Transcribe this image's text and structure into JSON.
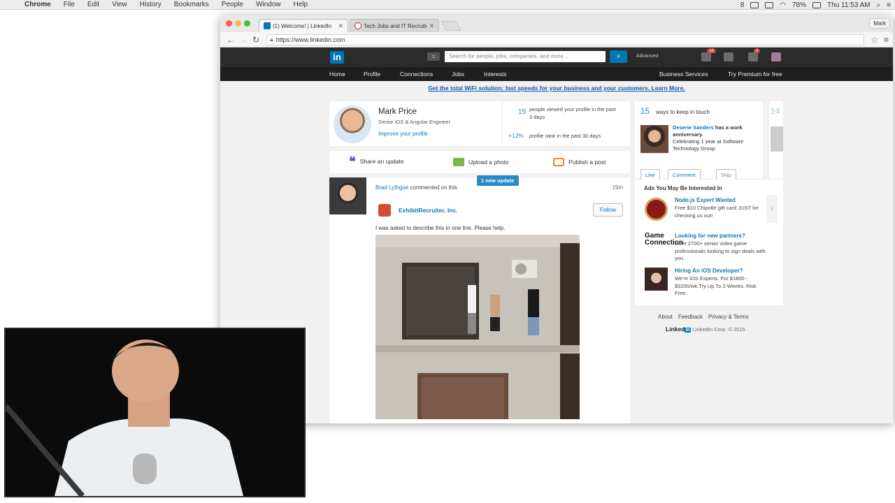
{
  "menubar": {
    "app": "Chrome",
    "items": [
      "File",
      "Edit",
      "View",
      "History",
      "Bookmarks",
      "People",
      "Window",
      "Help"
    ],
    "battery": "78%",
    "clock": "Thu 11:53 AM",
    "notif_count": "8"
  },
  "browser": {
    "tabs": [
      {
        "title": "(1) Welcome! | LinkedIn",
        "active": true
      },
      {
        "title": "Tech Jobs and IT Recruite",
        "active": false
      }
    ],
    "profile_name": "Mark",
    "url": "https://www.linkedin.com"
  },
  "linkedin": {
    "logo": "in",
    "search_placeholder": "Search for people, jobs, companies, and more...",
    "advanced": "Advanced",
    "messages_badge": "18",
    "notifications_badge": "3",
    "nav": [
      "Home",
      "Profile",
      "Connections",
      "Jobs",
      "Interests"
    ],
    "nav_right": [
      "Business Services",
      "Try Premium for free"
    ],
    "banner": "Get the total WiFi solution: fast speeds for your business and your customers. Learn More.",
    "profile": {
      "name": "Mark Price",
      "title": "Senior iOS & Angular Engineer",
      "improve": "Improve your profile",
      "views_num": "15",
      "views_text": "people viewed your profile in the past 3 days",
      "rank_num": "+12%",
      "rank_text": "profile rank in the past 30 days"
    },
    "share": {
      "update": "Share an update",
      "photo": "Upload a photo",
      "post": "Publish a post"
    },
    "new_update": "1 new update",
    "feed": {
      "actor": "Brad Lythgoe",
      "action": "commented on this",
      "time": "19m",
      "company": "ExhibitRecruiter, Inc.",
      "follow": "Follow",
      "text": "I was asked to describe this in one line. Please help."
    },
    "keep_in_touch": {
      "num": "15",
      "label": "ways to keep in touch",
      "next_num": "14",
      "person": "Deserie Sanders",
      "event": "has a work anniversary.",
      "detail": "Celebrating 1 year at Software Technology Group",
      "buttons": [
        "Like",
        "Comment",
        "Skip"
      ]
    },
    "ads": {
      "heading": "Ads You May Be Interested In",
      "items": [
        {
          "title": "Node.js Expert Wanted",
          "desc": "Free $10 Chipotle gift card JUST for checking us out!"
        },
        {
          "title": "Looking for new partners?",
          "desc": "Meet 2700+ senior video game professionals looking to sign deals with you."
        },
        {
          "title": "Hiring An iOS Developer?",
          "desc": "We're iOS Experts. For $1800 - $3200/wk.Try Up To 2-Weeks, Risk Free."
        }
      ],
      "game_logo": "Game Connection"
    },
    "footer": {
      "links": [
        "About",
        "Feedback",
        "Privacy & Terms"
      ],
      "copyright": "LinkedIn Corp. © 2015",
      "brand": "Linked"
    }
  }
}
